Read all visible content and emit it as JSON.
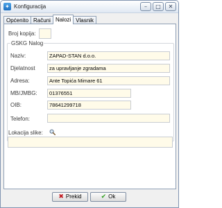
{
  "window": {
    "title": "Konfiguracija",
    "controls": {
      "minimize": "–",
      "maximize": "□",
      "close": "✕"
    }
  },
  "tabs": [
    {
      "label": "Općenito"
    },
    {
      "label": "Računi"
    },
    {
      "label": "Nalozi",
      "active": true
    },
    {
      "label": "Vlasnik"
    }
  ],
  "panel": {
    "copies": {
      "label": "Broj kopija:",
      "value": ""
    },
    "group": {
      "title": "GSKG Nalog",
      "fields": [
        {
          "label": "Naziv:",
          "value": "ZAPAD-STAN d.o.o."
        },
        {
          "label": "Djelatnost",
          "value": "za upravljanje zgradama"
        },
        {
          "label": "Adresa:",
          "value": "Ante Topića Mimare 61"
        },
        {
          "label": "MB/JMBG:",
          "value": "01376551"
        },
        {
          "label": "OIB:",
          "value": "78641299718"
        },
        {
          "label": "Telefon:",
          "value": ""
        }
      ]
    },
    "image": {
      "label": "Lokacija slike:",
      "value": ""
    }
  },
  "buttons": {
    "cancel": {
      "label": "Prekid",
      "icon": "✖"
    },
    "ok": {
      "label": "Ok",
      "icon": "✔"
    }
  },
  "colors": {
    "field_bg": "#fffbe9",
    "cancel_icon": "#c0181f",
    "ok_icon": "#2f9e1e"
  }
}
